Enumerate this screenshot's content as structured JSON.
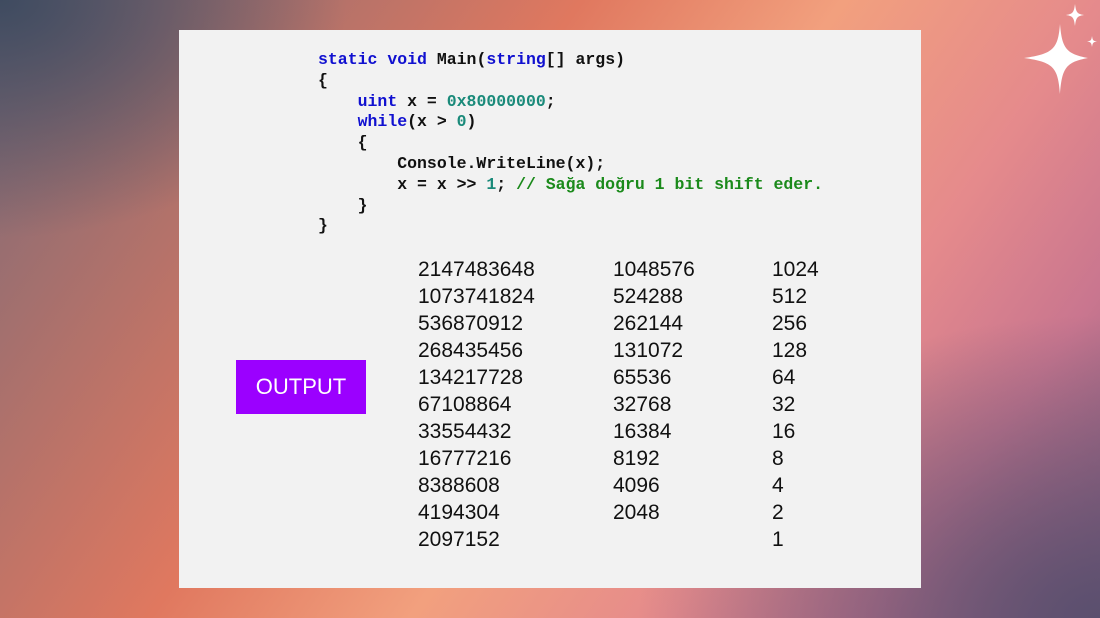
{
  "code": {
    "line1": {
      "kw1": "static",
      "kw2": "void",
      "name": "Main(",
      "kw3": "string",
      "rest": "[] args)"
    },
    "line2": "{",
    "line3": {
      "kw": "uint",
      "mid": " x = ",
      "num": "0x80000000",
      "end": ";"
    },
    "line4": {
      "kw": "while",
      "mid": "(x > ",
      "num": "0",
      "end": ")"
    },
    "line5": "{",
    "line6": "Console.WriteLine(x);",
    "line7": {
      "pre": "x = x >> ",
      "num": "1",
      "semi": "; ",
      "comment": "// Sağa doğru 1 bit shift eder."
    },
    "line8": "}",
    "line9": "}"
  },
  "output_label": "OUTPUT",
  "output": {
    "col1": [
      "2147483648",
      "1073741824",
      "536870912",
      "268435456",
      "134217728",
      "67108864",
      "33554432",
      "16777216",
      "8388608",
      "4194304",
      "2097152"
    ],
    "col2": [
      "1048576",
      "524288",
      "262144",
      "131072",
      "65536",
      "32768",
      "16384",
      "8192",
      "4096",
      "2048"
    ],
    "col3": [
      "1024",
      "512",
      "256",
      "128",
      "64",
      "32",
      "16",
      "8",
      "4",
      "2",
      "1"
    ]
  }
}
